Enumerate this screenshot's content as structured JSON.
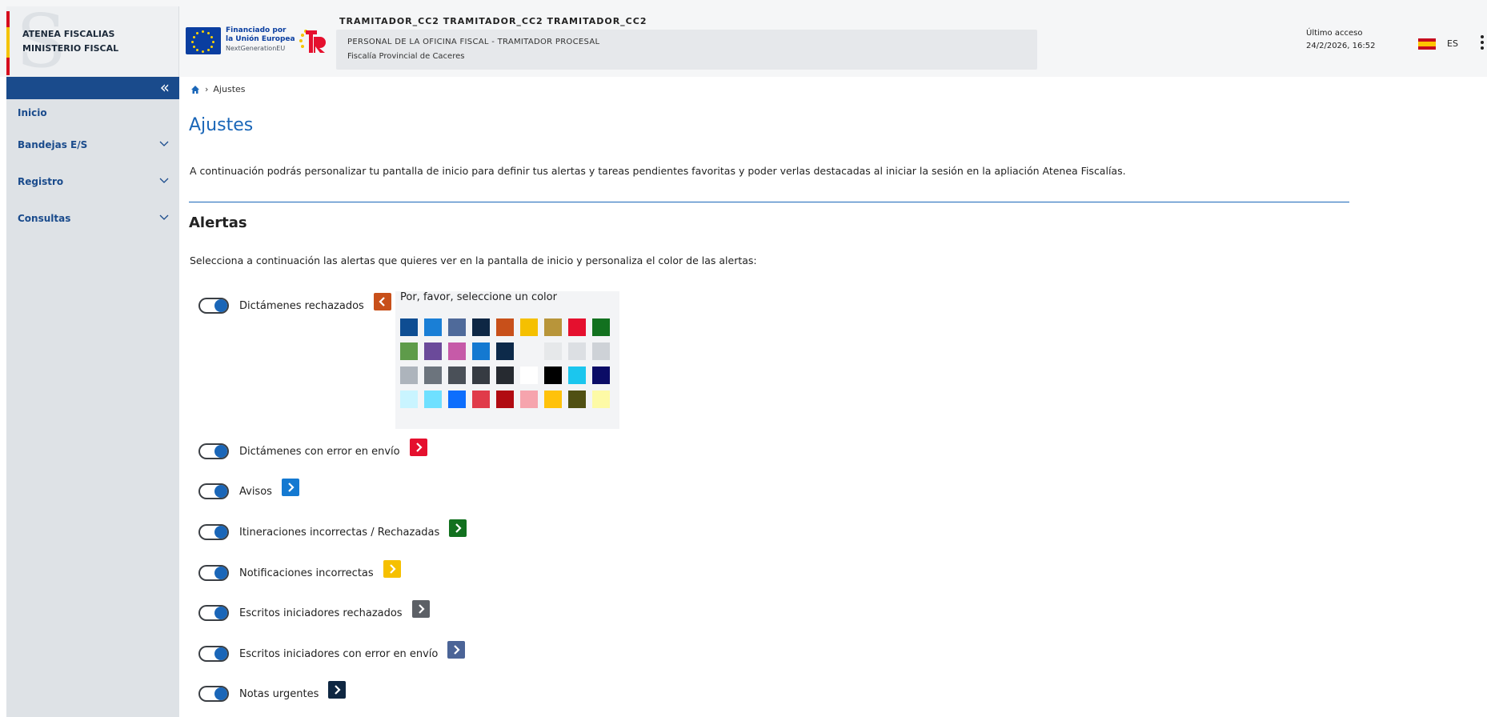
{
  "header": {
    "org_line1": "ATENEA FISCALIAS",
    "org_line2": "MINISTERIO FISCAL",
    "eu_line1": "Financiado por",
    "eu_line2": "la Unión Europea",
    "eu_line3": "NextGenerationEU",
    "user_name": "TRAMITADOR_CC2 TRAMITADOR_CC2 TRAMITADOR_CC2",
    "role": "PERSONAL DE LA OFICINA FISCAL - TRAMITADOR PROCESAL",
    "office": "Fiscalía Provincial de Caceres",
    "last_access_label": "Último acceso",
    "last_access_value": "24/2/2026, 16:52",
    "language": "ES"
  },
  "sidebar": {
    "items": [
      {
        "label": "Inicio"
      },
      {
        "label": "Bandejas E/S"
      },
      {
        "label": "Registro"
      },
      {
        "label": "Consultas"
      }
    ]
  },
  "breadcrumb": {
    "current": "Ajustes"
  },
  "page": {
    "title": "Ajustes",
    "intro": "A continuación podrás personalizar tu pantalla de inicio para definir tus alertas y tareas pendientes favoritas y poder verlas destacadas al iniciar la sesión en la apliación Atenea Fiscalías.",
    "alerts_title": "Alertas",
    "alerts_desc": "Selecciona a continuación las alertas que quieres ver en la pantalla de inicio y personaliza el color de las alertas:"
  },
  "alerts": [
    {
      "label": "Dictámenes rechazados",
      "color": "#c8501a",
      "enabled": true
    },
    {
      "label": "Dictámenes con error en envío",
      "color": "#e5102e",
      "enabled": true
    },
    {
      "label": "Avisos",
      "color": "#1479d1",
      "enabled": true
    },
    {
      "label": "Itineraciones incorrectas / Rechazadas",
      "color": "#12711f",
      "enabled": true
    },
    {
      "label": "Notificaciones incorrectas",
      "color": "#f6c000",
      "enabled": true
    },
    {
      "label": "Escritos iniciadores rechazados",
      "color": "#5c6066",
      "enabled": true
    },
    {
      "label": "Escritos iniciadores con error en envío",
      "color": "#4b6497",
      "enabled": true
    },
    {
      "label": "Notas urgentes",
      "color": "#0f2742",
      "enabled": true
    }
  ],
  "color_picker": {
    "title": "Por, favor, seleccione un color",
    "swatches": [
      "#0e4d92",
      "#1a7fd6",
      "#4f6a9a",
      "#0e2744",
      "#c8501a",
      "#f5c000",
      "#b8953a",
      "#e5102e",
      "#12711f",
      "#5e9b4a",
      "#6b4a9a",
      "#c65aa8",
      "#1479d1",
      "#0d2a4a",
      "#f3f4f6",
      "#e6e8ea",
      "#dcdfe3",
      "#ced2d7",
      "#adb4bc",
      "#6c747d",
      "#4a5058",
      "#363b42",
      "#262a30",
      "#ffffff",
      "#000000",
      "#1bc6ee",
      "#0b0c66",
      "#c9f4ff",
      "#6fe0ff",
      "#0d6efd",
      "#e03b4a",
      "#b10b12",
      "#f6a4ad",
      "#ffc20a",
      "#505013",
      "#fdfaa6"
    ]
  }
}
